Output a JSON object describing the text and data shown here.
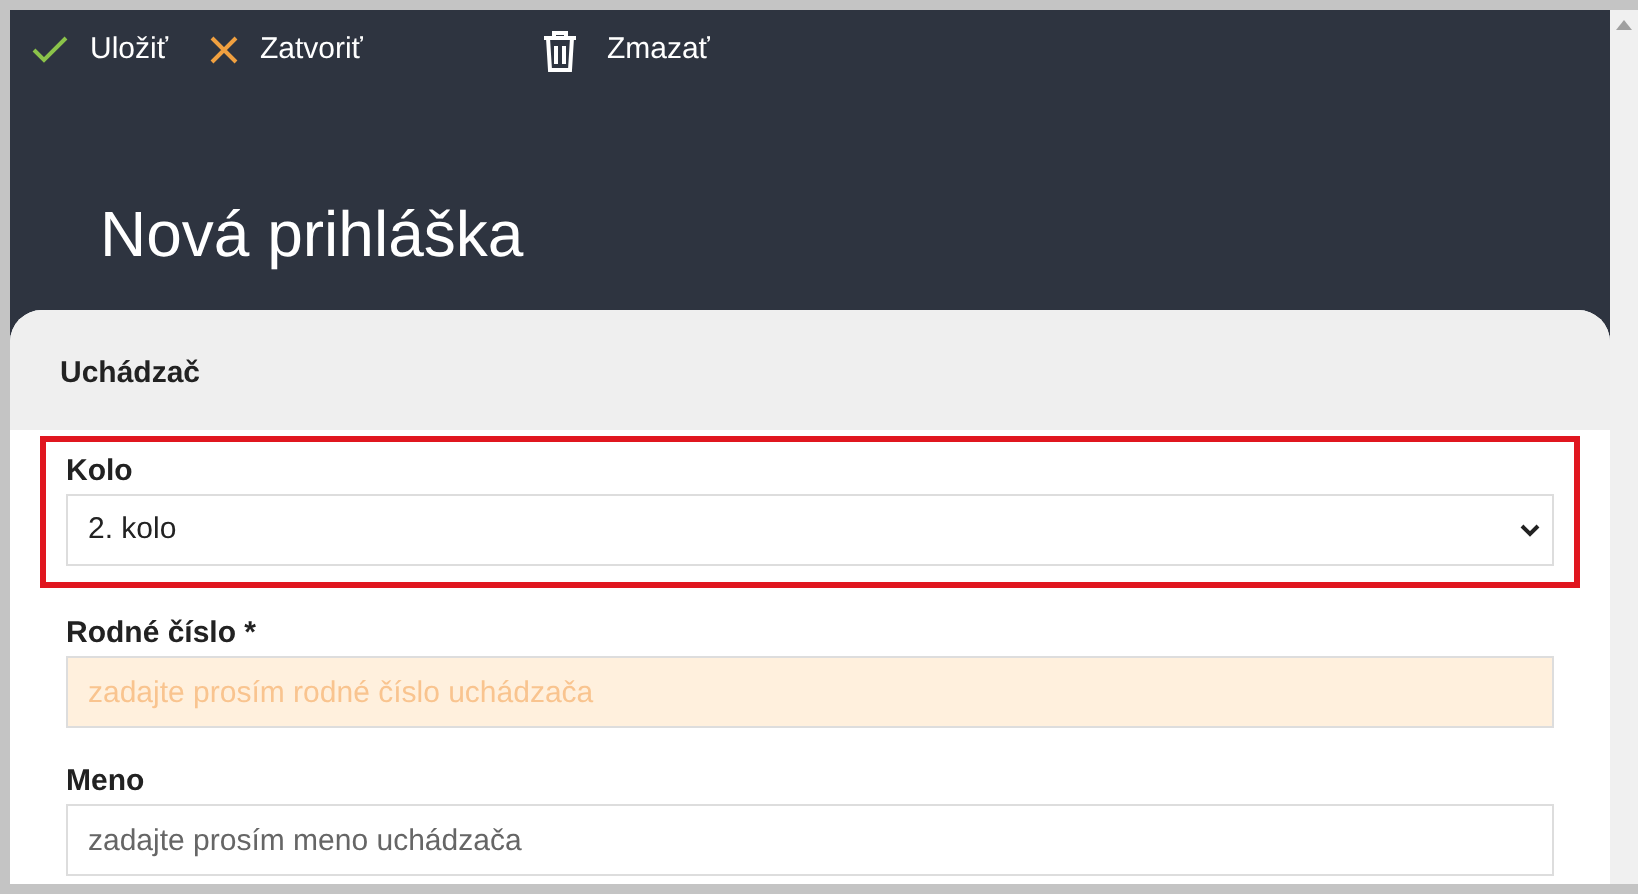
{
  "toolbar": [
    {
      "kind": "check",
      "label": "Uložiť"
    },
    {
      "kind": "close",
      "label": "Zatvoriť"
    },
    {
      "kind": "trash",
      "label": "Zmazať"
    }
  ],
  "title": "Nová prihláška",
  "section": {
    "title": "Uchádzač"
  },
  "fields": [
    {
      "kind": "select",
      "label": "Kolo",
      "value": "2. kolo",
      "highlighted": true
    },
    {
      "kind": "text",
      "label": "Rodné číslo *",
      "placeholder": "zadajte prosím rodné číslo uchádzača",
      "highlighted": false,
      "invalid": true
    },
    {
      "kind": "text",
      "label": "Meno",
      "placeholder": "zadajte prosím meno uchádzača",
      "highlighted": false,
      "invalid": false
    }
  ]
}
